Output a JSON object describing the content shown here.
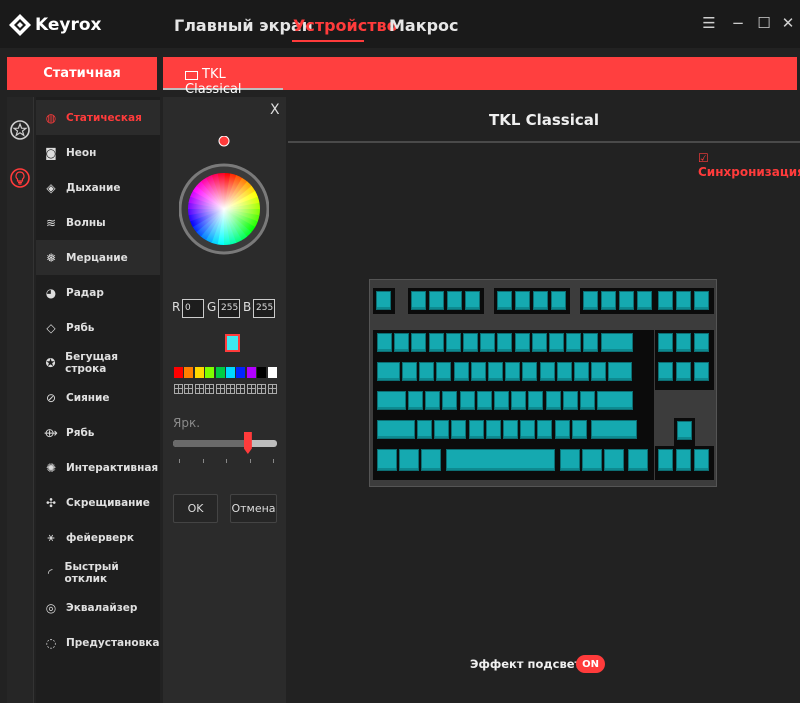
{
  "app": {
    "name": "Keyrox"
  },
  "nav": {
    "home": "Главный экран",
    "device": "Устройство",
    "macro": "Макрос"
  },
  "window": {
    "menu": "☰",
    "minimize": "−",
    "maximize": "☐",
    "close": "✕"
  },
  "mode": {
    "label": "Статичная"
  },
  "device": {
    "tab_label": "TKL Classical",
    "title": "TKL Classical"
  },
  "effects": [
    {
      "label": "Статическая",
      "icon": "static-icon",
      "glyph": "◍"
    },
    {
      "label": "Неон",
      "icon": "neon-icon",
      "glyph": "◙"
    },
    {
      "label": "Дыхание",
      "icon": "breathing-icon",
      "glyph": "◈"
    },
    {
      "label": "Волны",
      "icon": "waves-icon",
      "glyph": "≋"
    },
    {
      "label": "Мерцание",
      "icon": "sparkle-icon",
      "glyph": "❅"
    },
    {
      "label": "Радар",
      "icon": "radar-icon",
      "glyph": "◕"
    },
    {
      "label": "Рябь",
      "icon": "ripple-icon",
      "glyph": "◇"
    },
    {
      "label": "Бегущая строка",
      "icon": "marquee-icon",
      "glyph": "✪"
    },
    {
      "label": "Сияние",
      "icon": "glow-icon",
      "glyph": "⊘"
    },
    {
      "label": "Рябь",
      "icon": "ripple2-icon",
      "glyph": "⟴"
    },
    {
      "label": "Интерактивная",
      "icon": "interactive-icon",
      "glyph": "✺"
    },
    {
      "label": "Скрещивание",
      "icon": "crossing-icon",
      "glyph": "✣"
    },
    {
      "label": "фейерверк",
      "icon": "firework-icon",
      "glyph": "⚹"
    },
    {
      "label": "Быстрый отклик",
      "icon": "quick-response-icon",
      "glyph": "◜"
    },
    {
      "label": "Эквалайзер",
      "icon": "equalizer-icon",
      "glyph": "◎"
    },
    {
      "label": "Предустановка",
      "icon": "preset-icon",
      "glyph": "◌"
    }
  ],
  "color_picker": {
    "close": "X",
    "r_label": "R",
    "g_label": "G",
    "b_label": "B",
    "r": "0",
    "g": "255",
    "b": "255",
    "current_color": "#3ee8f0",
    "swatches": [
      "#ff0000",
      "#ff7f00",
      "#ffd800",
      "#7fff00",
      "#00cc44",
      "#00d8ff",
      "#0026ff",
      "#b200ff",
      "#000000",
      "#ffffff"
    ],
    "brightness_label": "Ярк.",
    "brightness": 0.72,
    "ok": "OK",
    "cancel": "Отмена"
  },
  "sync": {
    "label": "☑ Синхронизация"
  },
  "keyboard": {
    "key_color": "#15a9b0"
  },
  "footer": {
    "effect_label": "Эффект подсветки",
    "toggle": "ON"
  },
  "colors": {
    "accent": "#ff3b3b",
    "bg": "#222222"
  }
}
